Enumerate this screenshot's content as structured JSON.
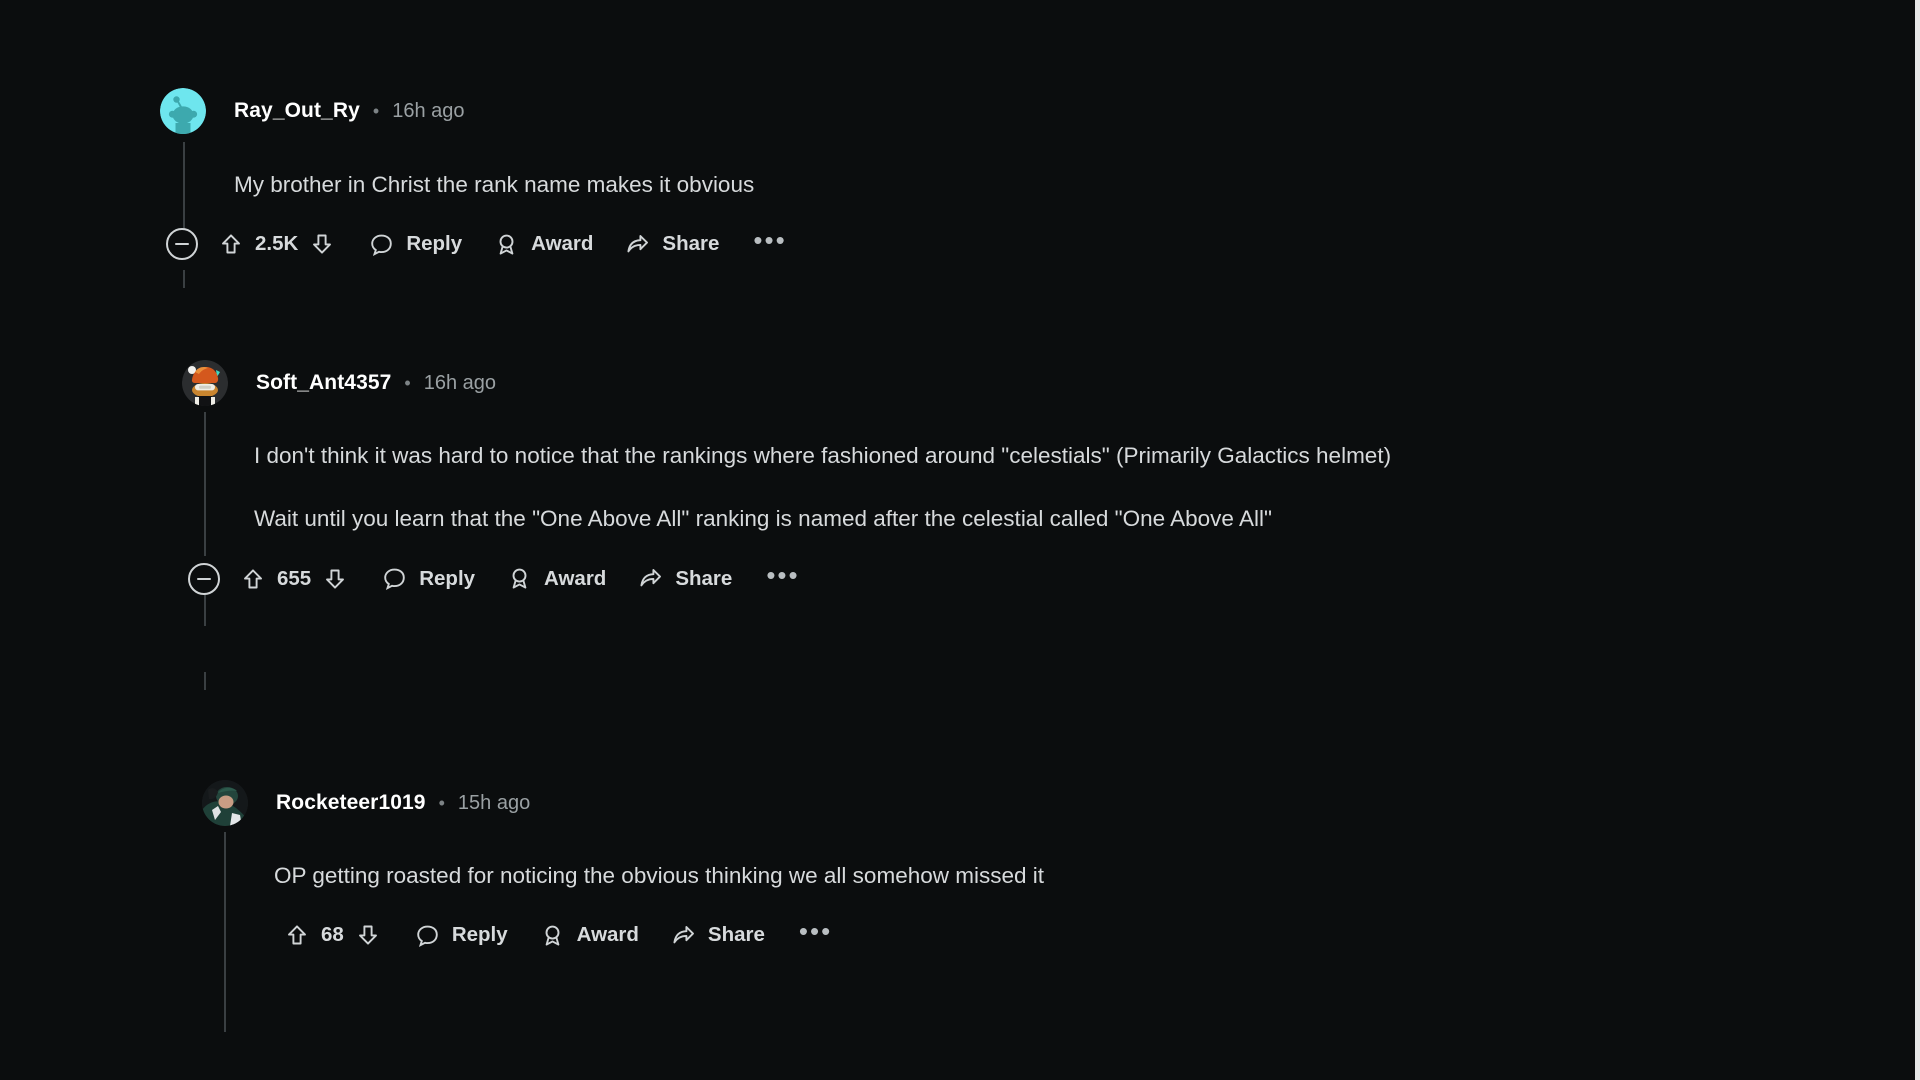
{
  "theme": {
    "background": "#0b0d0e",
    "text_primary": "#d7dadc",
    "text_muted": "#9aa0a3",
    "username": "#ffffff",
    "thread_line": "#3a3f42"
  },
  "separator": "•",
  "more_label": "•••",
  "comments": [
    {
      "id": "comment-1",
      "depth": 0,
      "username": "Ray_Out_Ry",
      "timestamp": "16h ago",
      "avatar": "reddit-snoo-cyan-avatar",
      "has_collapse": true,
      "paragraphs": [
        "My brother in Christ the rank name makes it obvious"
      ],
      "vote_count": "2.5K",
      "reply_label": "Reply",
      "award_label": "Award",
      "share_label": "Share"
    },
    {
      "id": "comment-2",
      "depth": 1,
      "username": "Soft_Ant4357",
      "timestamp": "16h ago",
      "avatar": "orange-character-avatar",
      "has_collapse": true,
      "paragraphs": [
        "I don't think it was hard to notice that the rankings where fashioned around \"celestials\" (Primarily Galactics helmet)",
        "Wait until you learn that the \"One Above All\" ranking is named after the celestial called \"One Above All\""
      ],
      "vote_count": "655",
      "reply_label": "Reply",
      "award_label": "Award",
      "share_label": "Share"
    },
    {
      "id": "comment-3",
      "depth": 2,
      "username": "Rocketeer1019",
      "timestamp": "15h ago",
      "avatar": "person-green-hoodie-avatar",
      "has_collapse": false,
      "paragraphs": [
        "OP getting roasted for noticing the obvious thinking we all somehow missed it"
      ],
      "vote_count": "68",
      "reply_label": "Reply",
      "award_label": "Award",
      "share_label": "Share"
    }
  ]
}
